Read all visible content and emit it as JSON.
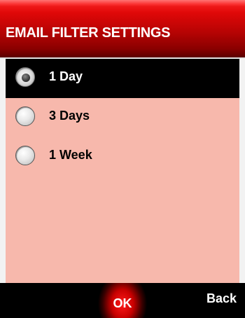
{
  "header": {
    "title": "EMAIL FILTER SETTINGS"
  },
  "options": [
    {
      "label": "1 Day",
      "selected": true
    },
    {
      "label": "3 Days",
      "selected": false
    },
    {
      "label": "1 Week",
      "selected": false
    }
  ],
  "softkeys": {
    "ok_label": "OK",
    "back_label": "Back"
  },
  "colors": {
    "title_bar": "#b80404",
    "background": "#f7b8ac",
    "selected_row": "#000000",
    "softkey_bar": "#000000",
    "ok_glow": "#ff1a1a"
  }
}
